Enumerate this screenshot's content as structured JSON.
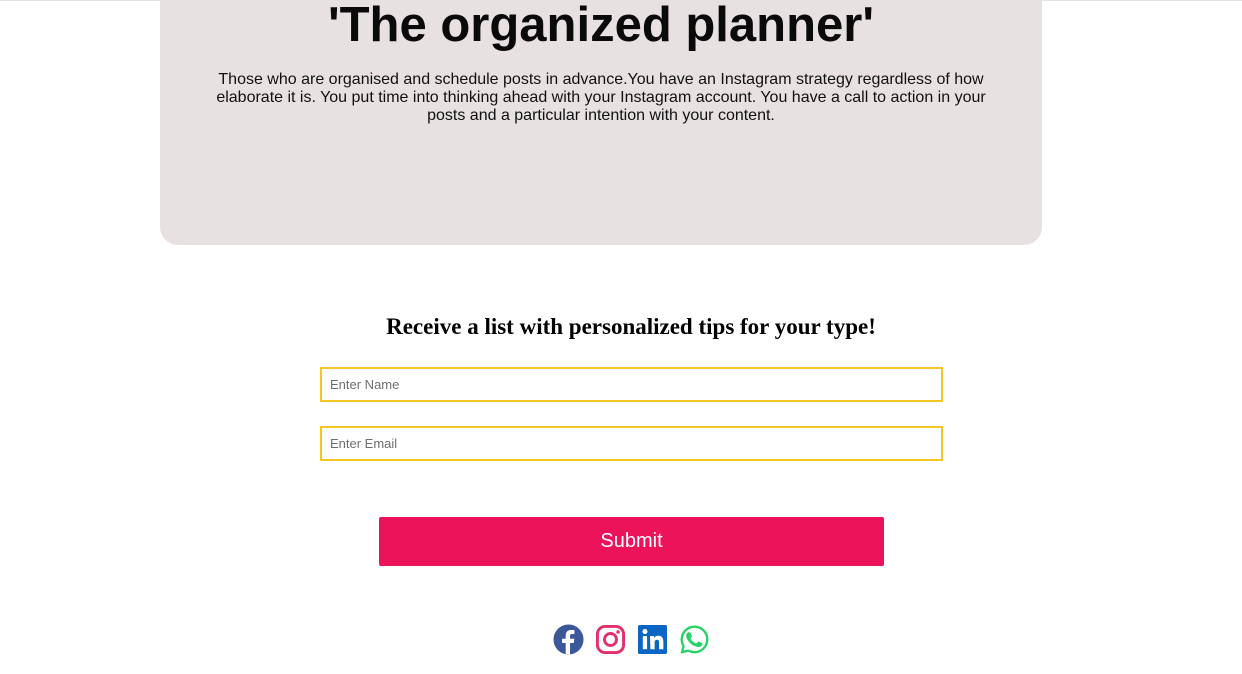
{
  "result": {
    "title": "'The organized planner'",
    "description": "Those who are organised and schedule posts in advance.You have an Instagram strategy regardless of how elaborate it is. You put time into thinking ahead with your Instagram account. You have a call to action in your posts and a particular intention with your content."
  },
  "signup": {
    "heading": "Receive a list with personalized tips for your type!",
    "name_placeholder": "Enter Name",
    "email_placeholder": "Enter Email",
    "submit_label": "Submit"
  },
  "social": [
    {
      "icon": "facebook-icon",
      "color": "#3b5998"
    },
    {
      "icon": "instagram-icon",
      "color": "#e1306c"
    },
    {
      "icon": "linkedin-icon",
      "color": "#0a66c2"
    },
    {
      "icon": "whatsapp-icon",
      "color": "#25d366"
    }
  ],
  "colors": {
    "card_background": "#e7e1e1",
    "input_border": "#f3c623",
    "submit_background": "#ec135b"
  }
}
